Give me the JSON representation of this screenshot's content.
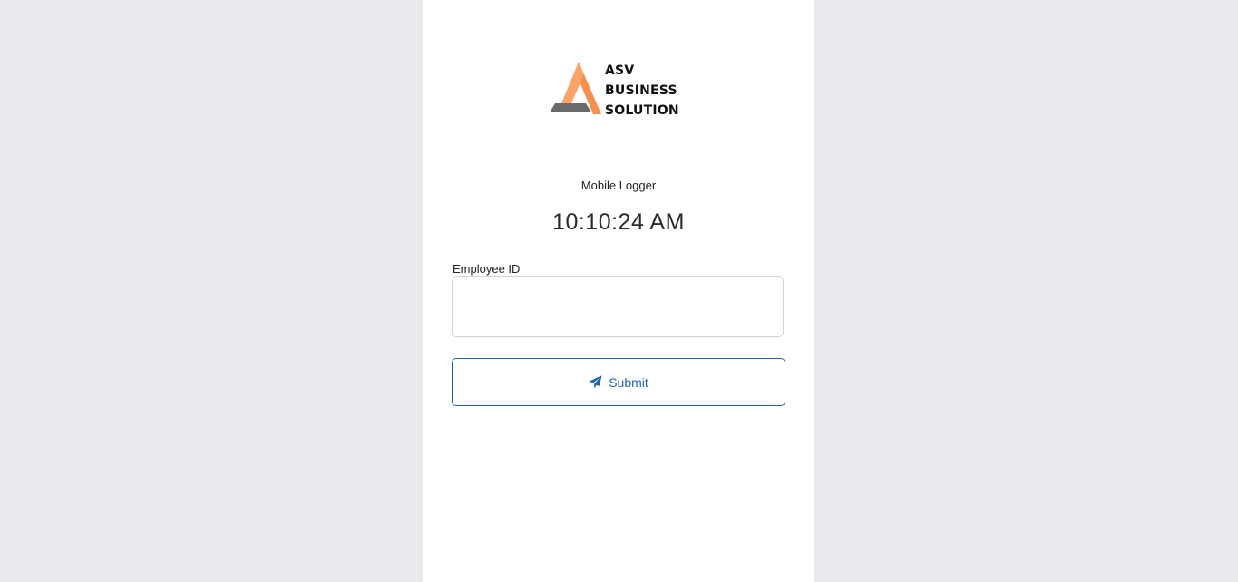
{
  "brand": {
    "lines": [
      "ASV",
      "BUSINESS",
      "SOLUTION"
    ],
    "colors": {
      "orange": "#f4914f",
      "gray": "#6b6b6b"
    }
  },
  "app": {
    "name": "Mobile Logger",
    "time": "10:10:24 AM"
  },
  "form": {
    "employee_id": {
      "label": "Employee ID",
      "value": "",
      "placeholder": ""
    },
    "submit": {
      "label": "Submit",
      "icon": "paper-plane-icon",
      "color": "#1f63b8"
    }
  }
}
